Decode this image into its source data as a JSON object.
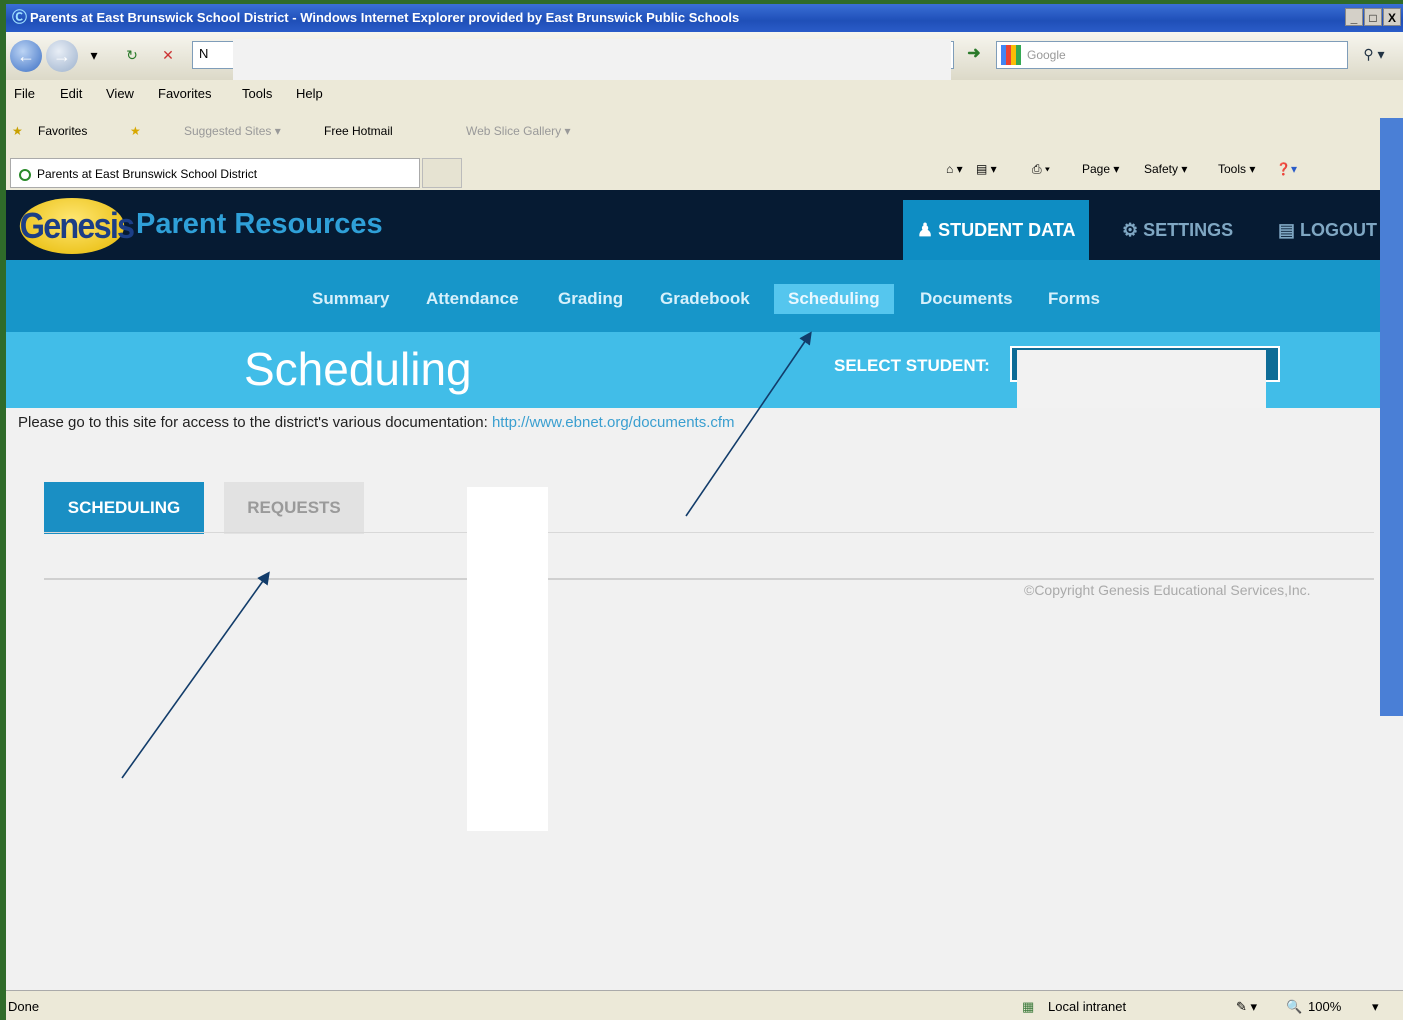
{
  "window": {
    "title": "Parents at East Brunswick School District - Windows Internet Explorer provided by East Brunswick Public Schools",
    "controls": [
      "_",
      "□",
      "X"
    ]
  },
  "address_bar": {
    "url_prefix": "N",
    "search_placeholder": "Google"
  },
  "menu": [
    "File",
    "Edit",
    "View",
    "Favorites",
    "Tools",
    "Help"
  ],
  "favorites_bar": {
    "favorites_label": "Favorites",
    "items": [
      "Suggested Sites ▾",
      "Free Hotmail",
      "Web Slice Gallery ▾"
    ]
  },
  "browser_tab": {
    "label": "Parents at East Brunswick School District"
  },
  "command_bar": [
    "Page ▾",
    "Safety ▾",
    "Tools ▾"
  ],
  "header": {
    "logo_text": "Genesis",
    "brand": "Parent Resources",
    "tabs": [
      {
        "label": "STUDENT DATA",
        "icon": "♟"
      },
      {
        "label": "SETTINGS",
        "icon": "⚙"
      },
      {
        "label": "LOGOUT",
        "icon": "🔒"
      }
    ]
  },
  "subnav": [
    "Summary",
    "Attendance",
    "Grading",
    "Gradebook",
    "Scheduling",
    "Documents",
    "Forms"
  ],
  "page": {
    "title": "Scheduling",
    "select_student_label": "SELECT STUDENT:",
    "doc_text": "Please go to this site for access to the district's various documentation:",
    "doc_link": "http://www.ebnet.org/documents.cfm",
    "tabs": [
      "SCHEDULING",
      "REQUESTS"
    ],
    "copyright": "©Copyright Genesis Educational Services,Inc."
  },
  "status_bar": {
    "left": "Done",
    "zone": "Local intranet",
    "zoom": "100%"
  },
  "colors": {
    "header_bg": "#061b33",
    "subnav_bg": "#1796c9",
    "title_band": "#41bde8",
    "active_tab": "#1a8fc4"
  }
}
